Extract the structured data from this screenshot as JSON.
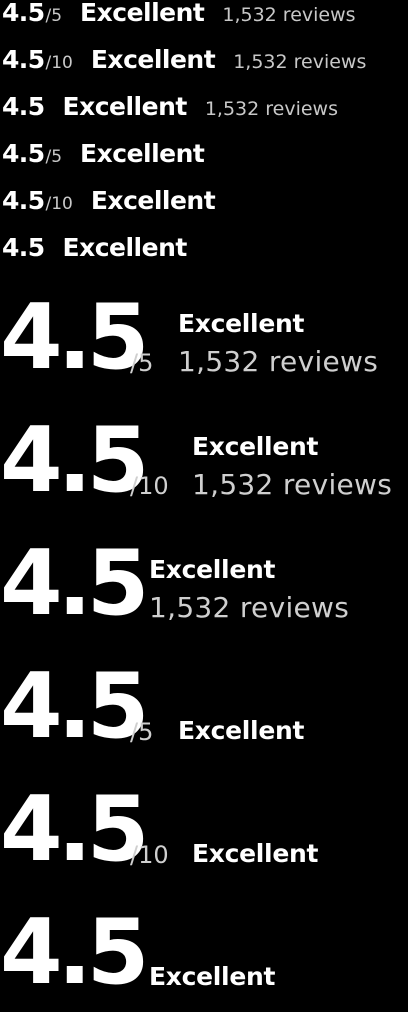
{
  "rating": {
    "score": "4.5",
    "scale_5": "/5",
    "scale_10": "/10",
    "label": "Excellent",
    "reviews": "1,532 reviews"
  }
}
